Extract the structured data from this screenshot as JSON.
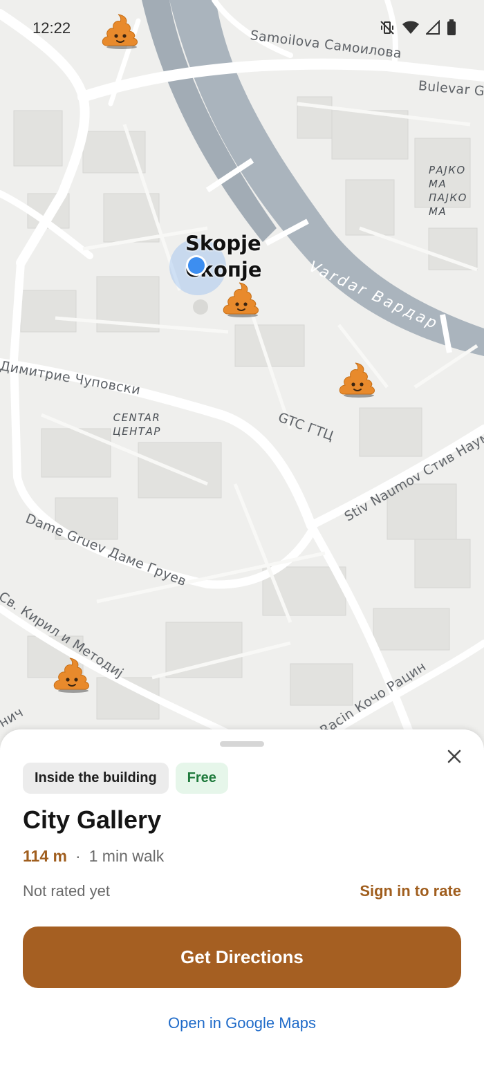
{
  "status_bar": {
    "time": "12:22",
    "icons": [
      "vibrate-off-icon",
      "wifi-icon",
      "signal-icon",
      "battery-icon"
    ]
  },
  "map": {
    "city_label": {
      "line1": "Skopje",
      "line2": "Скопје"
    },
    "river_label": "Vardar Вардар",
    "streets": {
      "samoilova": "Samoilova Самоилова",
      "bulevar": "Bulevar Go",
      "dimitrie": "Димитрие Чуповски",
      "dame_gruev": "Dame Gruev Даме Груев",
      "kiril": "Св. Кирил и Методиј",
      "stiv_naumov": "Stiv Naumov Стив Наумов",
      "racin": "Racin Кочо Рацин",
      "gtc": "GTC ГТЦ",
      "nich": "нич"
    },
    "districts": {
      "centar": {
        "line1": "CENTAR",
        "line2": "ЦЕНТАР"
      },
      "rajko": {
        "line1": "РАЈКО МА",
        "line2": "ПАЈКО МА"
      }
    },
    "marker_icon": "poop-emoji-icon",
    "colors": {
      "river": "#aab4bd",
      "marker": "#e88a2c",
      "location": "#3d8ef0"
    }
  },
  "sheet": {
    "chips": {
      "location": "Inside the building",
      "price": "Free"
    },
    "title": "City Gallery",
    "distance": "114 m",
    "separator": "·",
    "walk_time": "1 min walk",
    "rating": "Not rated yet",
    "sign_in": "Sign in to rate",
    "directions_button": "Get Directions",
    "google_maps_link": "Open in Google Maps",
    "colors": {
      "accent": "#a55f22",
      "link": "#1f6bc9",
      "free_chip_text": "#1f7a3c"
    }
  }
}
